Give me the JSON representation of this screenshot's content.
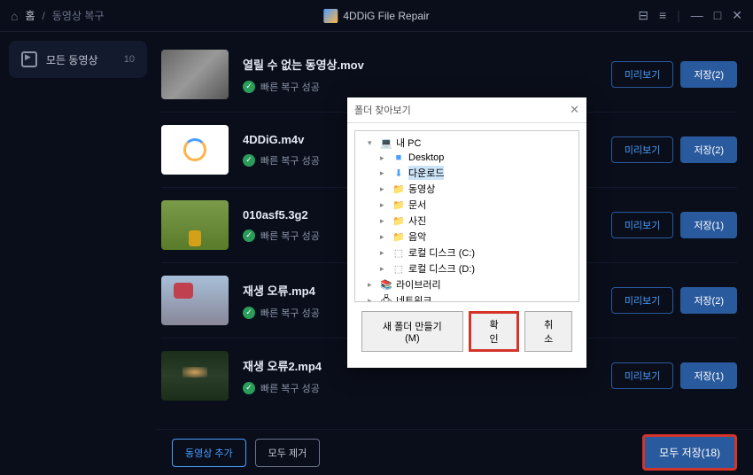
{
  "header": {
    "breadcrumb_home": "홈",
    "breadcrumb_current": "동영상 복구",
    "app_title": "4DDiG File Repair"
  },
  "sidebar": {
    "label": "모든 동영상",
    "count": "10"
  },
  "files": [
    {
      "name": "열릴 수 없는 동영상.mov",
      "status": "빠른 복구 성공",
      "preview": "미리보기",
      "save": "저장(2)"
    },
    {
      "name": "4DDiG.m4v",
      "status": "빠른 복구 성공",
      "preview": "미리보기",
      "save": "저장(2)"
    },
    {
      "name": "010asf5.3g2",
      "status": "빠른 복구 성공",
      "preview": "미리보기",
      "save": "저장(1)"
    },
    {
      "name": "재생 오류.mp4",
      "status": "빠른 복구 성공",
      "preview": "미리보기",
      "save": "저장(2)"
    },
    {
      "name": "재생 오류2.mp4",
      "status": "빠른 복구 성공",
      "preview": "미리보기",
      "save": "저장(1)"
    }
  ],
  "bottom": {
    "add": "동영상 추가",
    "remove": "모두 제거",
    "save_all": "모두 저장(18)"
  },
  "dialog": {
    "title": "폴더 찾아보기",
    "tree": {
      "pc": "내 PC",
      "desktop": "Desktop",
      "downloads": "다운로드",
      "videos": "동영상",
      "documents": "문서",
      "pictures": "사진",
      "music": "음악",
      "disk_c": "로컬 디스크 (C:)",
      "disk_d": "로컬 디스크 (D:)",
      "libraries": "라이브러리",
      "network": "네트워크"
    },
    "new_folder": "새 폴더 만들기(M)",
    "ok": "확인",
    "cancel": "취소"
  }
}
